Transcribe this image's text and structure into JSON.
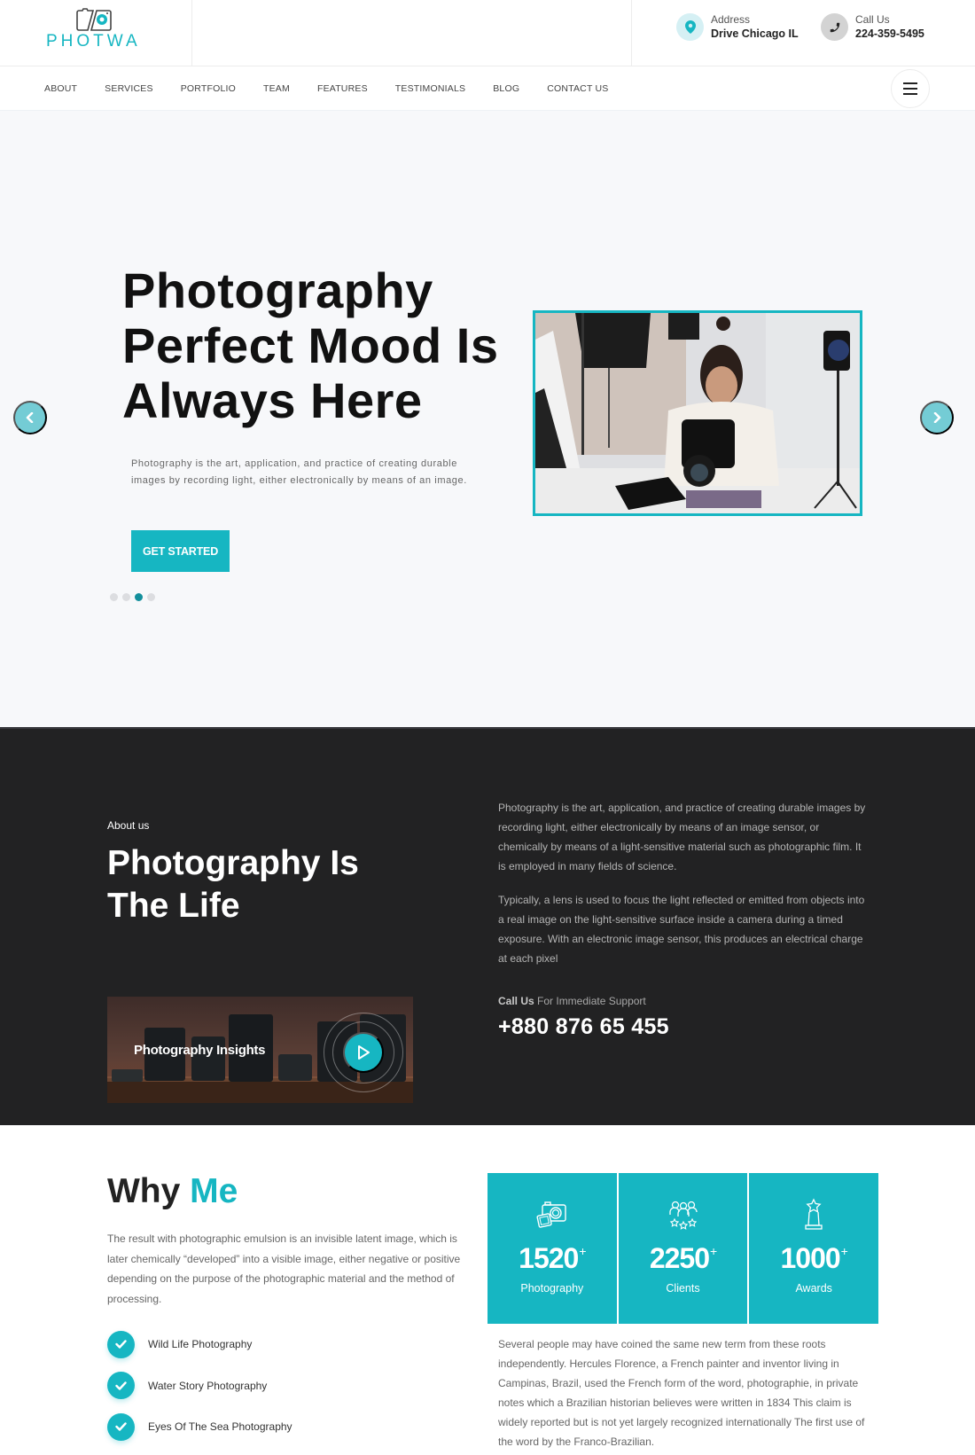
{
  "brand": {
    "name": "PHOTWA",
    "accent_color": "#16b6c2"
  },
  "header": {
    "address": {
      "icon": "map-pin-icon",
      "label": "Address",
      "value": "Drive Chicago IL"
    },
    "call": {
      "icon": "phone-icon",
      "label": "Call Us",
      "value": "224-359-5495"
    }
  },
  "nav": {
    "items": [
      "ABOUT",
      "SERVICES",
      "PORTFOLIO",
      "TEAM",
      "FEATURES",
      "TESTIMONIALS",
      "BLOG",
      "CONTACT US"
    ],
    "menu_icon": "hamburger-menu-icon"
  },
  "hero": {
    "title_lines": [
      "Photography",
      "Perfect Mood Is",
      "Always Here"
    ],
    "description": "Photography is the art, application, and practice of creating durable images by recording light, either electronically by means of an image.",
    "cta_label": "GET STARTED",
    "slides_total": 4,
    "active_slide": 3,
    "prev_icon": "chevron-left-icon",
    "next_icon": "chevron-right-icon",
    "image_alt": "Woman photographer smiling while checking a DSLR camera in a studio"
  },
  "about": {
    "kicker": "About us",
    "title_lines": [
      "Photography Is",
      "The Life"
    ],
    "paragraphs": [
      "Photography is the art, application, and practice of creating durable images by recording light, either electronically by means of an image sensor, or chemically by means of a light-sensitive material such as photographic film. It is employed in many fields of science.",
      "Typically, a lens is used to focus the light reflected or emitted from objects into a real image on the light-sensitive surface inside a camera during a timed exposure. With an electronic image sensor, this produces an electrical charge at each pixel"
    ],
    "support_bold": "Call Us",
    "support_rest": " For Immediate Support",
    "phone": "+880 876 65 455",
    "video": {
      "label": "Photography Insights",
      "icon": "play-icon"
    }
  },
  "why": {
    "title_plain": "Why",
    "title_accent": "Me",
    "description": "The result with photographic emulsion is an invisible latent image, which is later chemically “developed” into a visible image, either negative or positive depending on the purpose of the photographic material and the method of processing.",
    "checklist": [
      "Wild Life Photography",
      "Water Story Photography",
      "Eyes Of The Sea Photography"
    ],
    "stats": [
      {
        "icon": "camera-photos-icon",
        "value": "1520",
        "suffix": "+",
        "label": "Photography"
      },
      {
        "icon": "clients-stars-icon",
        "value": "2250",
        "suffix": "+",
        "label": "Clients"
      },
      {
        "icon": "award-trophy-icon",
        "value": "1000",
        "suffix": "+",
        "label": "Awards"
      }
    ],
    "description2": "Several people may have coined the same new term from these roots independently. Hercules Florence, a French painter and inventor living in Campinas, Brazil, used the French form of the word, photographie, in private notes which a Brazilian historian believes were written in 1834 This claim is widely reported but is not yet largely recognized internationally The first use of the word by the Franco-Brazilian."
  }
}
